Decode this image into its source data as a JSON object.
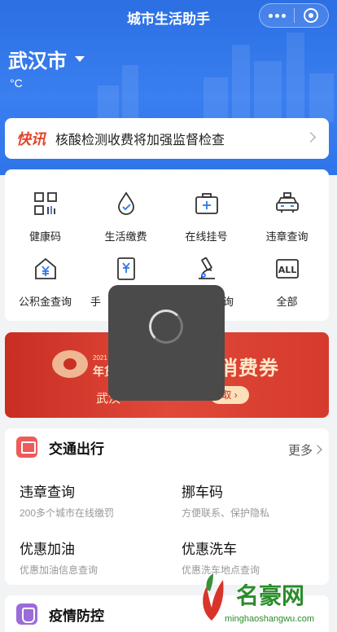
{
  "navbar": {
    "title": "城市生活助手"
  },
  "location": {
    "city": "武汉市",
    "temperature": "°C"
  },
  "news": {
    "tag": "快讯",
    "text": "核酸检测收费将加强监督检查"
  },
  "services": [
    {
      "label": "健康码",
      "icon": "health-code-icon"
    },
    {
      "label": "生活缴费",
      "icon": "utility-payment-icon"
    },
    {
      "label": "在线挂号",
      "icon": "hospital-registration-icon"
    },
    {
      "label": "违章查询",
      "icon": "car-violation-icon"
    },
    {
      "label": "公积金查询",
      "icon": "housing-fund-icon"
    },
    {
      "label": "手",
      "icon": "social-security-icon"
    },
    {
      "label": "查询",
      "icon": "microscope-icon"
    },
    {
      "label": "全部",
      "icon": "all-icon"
    }
  ],
  "banner": {
    "year_text": "2021 s",
    "sub_text": "年货",
    "title": "消费券",
    "city_text": "武汉",
    "button_text": "取"
  },
  "traffic": {
    "title": "交通出行",
    "more": "更多",
    "items": [
      {
        "title": "违章查询",
        "desc": "200多个城市在线缴罚"
      },
      {
        "title": "挪车码",
        "desc": "方便联系、保护隐私"
      },
      {
        "title": "优惠加油",
        "desc": "优惠加油信息查询"
      },
      {
        "title": "优惠洗车",
        "desc": "优惠洗车地点查询"
      }
    ]
  },
  "epidemic": {
    "title": "疫情防控"
  },
  "watermark": {
    "name": "名豪网",
    "url": "minghaoshangwu.com"
  },
  "colors": {
    "primary": "#2f74ea",
    "news_tag": "#e2452b",
    "banner": "#d63a2d"
  }
}
